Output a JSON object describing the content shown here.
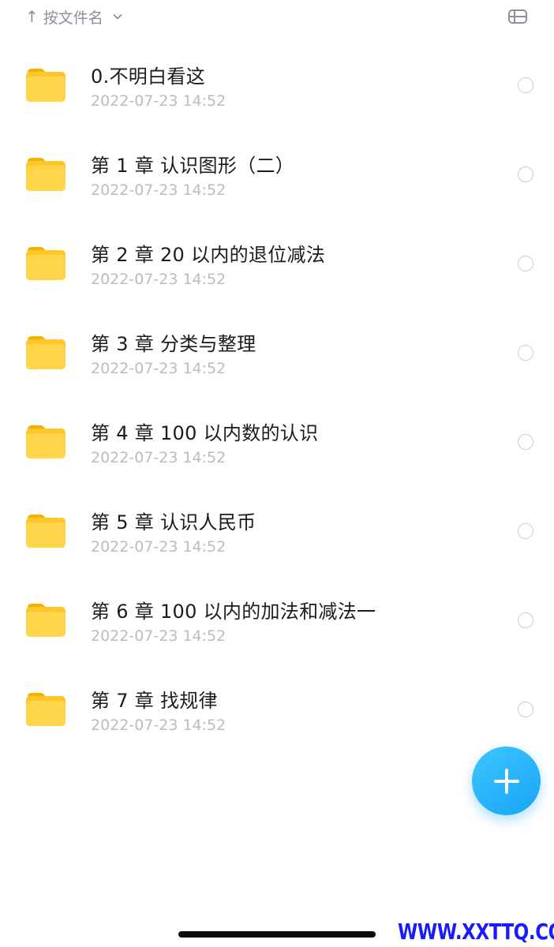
{
  "sort": {
    "arrow": "↑",
    "label": "按文件名",
    "chevron_icon": "chevron-down-icon"
  },
  "toolbar": {
    "view_toggle_icon": "list-view-icon"
  },
  "folders": [
    {
      "name": "0.不明白看这",
      "date": "2022-07-23 14:52"
    },
    {
      "name": "第 1 章  认识图形（二）",
      "date": "2022-07-23 14:52"
    },
    {
      "name": "第 2 章 20 以内的退位减法",
      "date": "2022-07-23 14:52"
    },
    {
      "name": "第 3 章  分类与整理",
      "date": "2022-07-23 14:52"
    },
    {
      "name": "第 4 章  100 以内数的认识",
      "date": "2022-07-23 14:52"
    },
    {
      "name": "第 5 章  认识人民币",
      "date": "2022-07-23 14:52"
    },
    {
      "name": "第 6 章  100 以内的加法和减法一",
      "date": "2022-07-23 14:52"
    },
    {
      "name": "第 7 章 找规律",
      "date": "2022-07-23 14:52"
    }
  ],
  "fab": {
    "icon": "plus-icon"
  },
  "watermark": "WWW.XXTTQ.COM",
  "colors": {
    "folder": "#FFCC33",
    "accent": "#16A4F7",
    "date_text": "#B9BCC3",
    "watermark": "#1A1AFF"
  }
}
